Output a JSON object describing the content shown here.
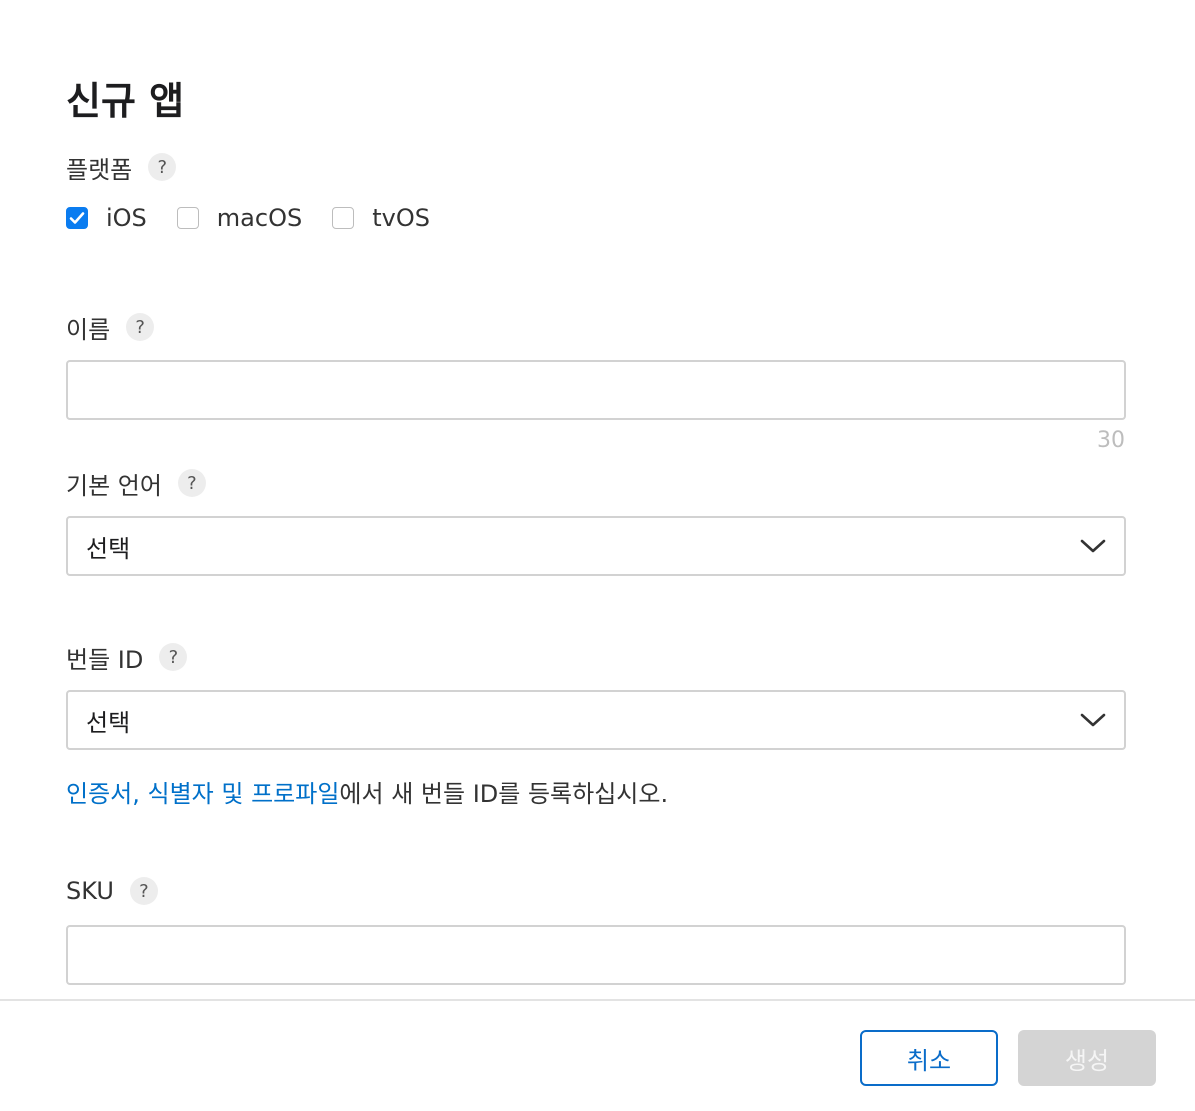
{
  "dialog": {
    "title": "신규 앱"
  },
  "platform": {
    "label": "플랫폼",
    "help": "?",
    "options": [
      {
        "label": "iOS",
        "checked": true
      },
      {
        "label": "macOS",
        "checked": false
      },
      {
        "label": "tvOS",
        "checked": false
      }
    ]
  },
  "name": {
    "label": "이름",
    "help": "?",
    "value": "",
    "counter": "30"
  },
  "primary_language": {
    "label": "기본 언어",
    "help": "?",
    "selected": "선택"
  },
  "bundle_id": {
    "label": "번들 ID",
    "help": "?",
    "selected": "선택",
    "info_link": "인증서, 식별자 및 프로파일",
    "info_rest": "에서 새 번들 ID를 등록하십시오."
  },
  "sku": {
    "label": "SKU",
    "help": "?",
    "value": ""
  },
  "footer": {
    "cancel_label": "취소",
    "create_label": "생성"
  },
  "colors": {
    "accent": "#0a7cf0",
    "link": "#0070c9",
    "disabled_button": "#d4d4d4"
  }
}
